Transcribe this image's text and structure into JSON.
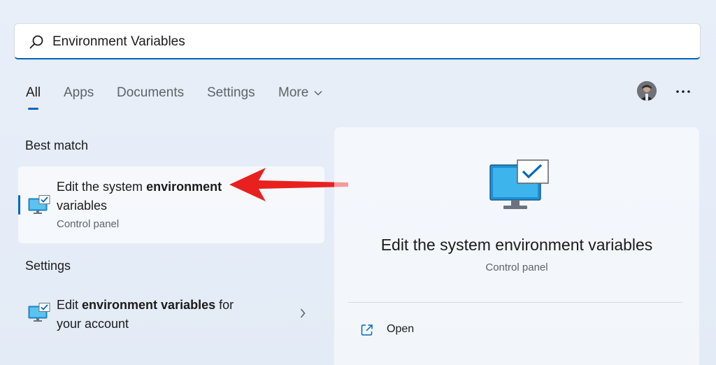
{
  "search": {
    "value": "Environment Variables",
    "icon": "search-icon"
  },
  "tabs": [
    {
      "label": "All",
      "active": true
    },
    {
      "label": "Apps",
      "active": false
    },
    {
      "label": "Documents",
      "active": false
    },
    {
      "label": "Settings",
      "active": false
    },
    {
      "label": "More",
      "active": false
    }
  ],
  "header": {
    "avatar_icon": "user-avatar",
    "more_icon": "ellipsis-icon"
  },
  "best_match": {
    "section_title": "Best match",
    "item": {
      "title_prefix": "Edit the system ",
      "title_bold": "environment",
      "title_line2": "variables",
      "subtitle": "Control panel",
      "icon": "monitor-check-icon"
    }
  },
  "settings": {
    "section_title": "Settings",
    "item": {
      "title_prefix": "Edit ",
      "title_bold": "environment variables",
      "title_suffix": " for",
      "title_line2": "your account",
      "icon": "monitor-check-icon"
    }
  },
  "preview": {
    "title": "Edit the system environment variables",
    "subtitle": "Control panel",
    "actions": [
      {
        "label": "Open",
        "icon": "open-external-icon"
      }
    ]
  },
  "colors": {
    "accent": "#0067c0",
    "annotation_arrow": "#e8211f"
  }
}
